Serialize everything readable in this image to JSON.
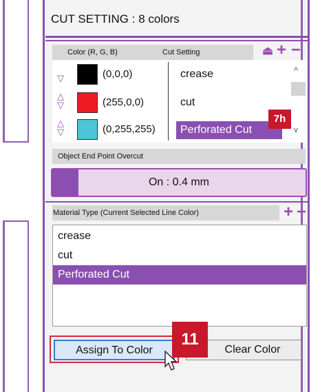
{
  "panel": {
    "title": "CUT SETTING : 8 colors"
  },
  "color_table": {
    "header_color": "Color (R, G, B)",
    "header_cut": "Cut Setting",
    "add_icon": "+",
    "remove_icon": "−",
    "eject_icon": "⏏",
    "rows": [
      {
        "rgb": "(0,0,0)",
        "swatch": "#000000",
        "cut_setting": "crease",
        "selected": false
      },
      {
        "rgb": "(255,0,0)",
        "swatch": "#ed1c24",
        "cut_setting": "cut",
        "selected": false
      },
      {
        "rgb": "(0,255,255)",
        "swatch": "#4dc4d8",
        "cut_setting": "Perforated Cut",
        "selected": true
      }
    ],
    "callout": "7h"
  },
  "overcut": {
    "header": "Object End Point Overcut",
    "value": "On : 0.4 mm"
  },
  "material": {
    "header": "Material Type (Current Selected Line Color)",
    "items": [
      {
        "label": "crease",
        "selected": false
      },
      {
        "label": "cut",
        "selected": false
      },
      {
        "label": "Perforated Cut",
        "selected": true
      }
    ]
  },
  "buttons": {
    "assign": "Assign To Color",
    "clear": "Clear Color",
    "callout": "11"
  },
  "colors": {
    "accent": "#8a4fb0",
    "callout_red": "#c8182a"
  }
}
